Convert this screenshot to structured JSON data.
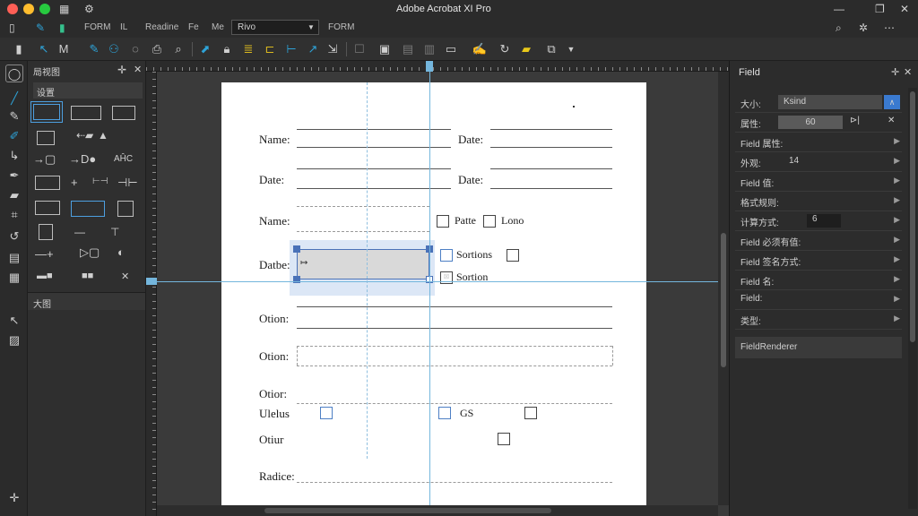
{
  "window": {
    "title": "Adobe Acrobat XI Pro",
    "traffic_colors": [
      "#ff5f56",
      "#ffbd2e",
      "#27c93f"
    ]
  },
  "menubar": {
    "items": [
      "FORM",
      "IL",
      "Readine",
      "Fe",
      "Me",
      "FORM"
    ],
    "select_value": "Rivo"
  },
  "left_panel": {
    "header1": "局视图",
    "header2": "设置",
    "header3": "大图",
    "label_ahc": "AĤC"
  },
  "page": {
    "labels": {
      "name1": "Name:",
      "date1": "Date:",
      "date2": "Date:",
      "date3": "Date:",
      "name2": "Name:",
      "patte": "Patte",
      "lono": "Lono",
      "datbe": "Datbe:",
      "sortions": "Sortions",
      "sortion": "Sortion",
      "otion1": "Otion:",
      "otion2": "Otion:",
      "otior": "Otior:",
      "ulelus": "Ulelus",
      "otiur": "Otiur",
      "radice": "Radice:",
      "gs": "GS"
    }
  },
  "right_panel": {
    "title": "Field",
    "rows": [
      {
        "label": "大小:",
        "value": "Ksind"
      },
      {
        "label": "属性:",
        "value": "60"
      },
      {
        "label": "Field 属性:",
        "value": ""
      },
      {
        "label": "外观:",
        "value": "14"
      },
      {
        "label": "Field 值:",
        "value": ""
      },
      {
        "label": "格式规则:",
        "value": ""
      },
      {
        "label": "计算方式:",
        "value": "6"
      },
      {
        "label": "Field 必须有值:",
        "value": ""
      },
      {
        "label": "Field 签名方式:",
        "value": ""
      },
      {
        "label": "Field 名:",
        "value": ""
      },
      {
        "label": "Field:",
        "value": ""
      },
      {
        "label": "类型:",
        "value": ""
      },
      {
        "label": "FieldRenderer",
        "value": ""
      }
    ]
  }
}
